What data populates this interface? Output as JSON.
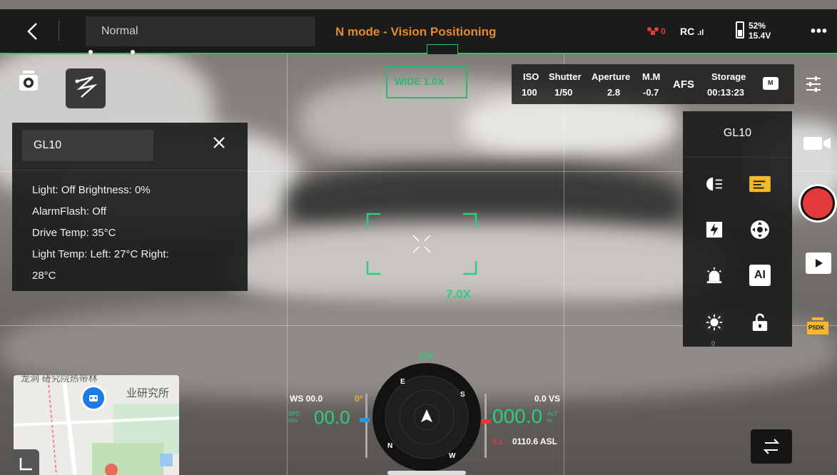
{
  "topbar": {
    "mode": "Normal",
    "status": "N mode - Vision Positioning",
    "drone_count": "0",
    "rc_label": "RC",
    "battery_percent": "52%",
    "battery_voltage": "15.4V",
    "more": "•••"
  },
  "lens": {
    "wide": "WIDE 1.0X",
    "zoom": "7.0X"
  },
  "gl10_panel": {
    "title": "GL10",
    "lines": [
      "Light: Off   Brightness: 0%",
      "AlarmFlash: Off",
      "Drive Temp: 35°C",
      "Light Temp: Left: 27°C  Right:",
      "28°C"
    ]
  },
  "exposure": {
    "iso_label": "ISO",
    "iso_value": "100",
    "shutter_label": "Shutter",
    "shutter_value": "1/50",
    "aperture_label": "Aperture",
    "aperture_value": "2.8",
    "mm_label": "M.M",
    "mm_value": "-0.7",
    "focus_mode": "AFS",
    "storage_label": "Storage",
    "storage_value": "00:13:23",
    "storage_badge": "M"
  },
  "tool_panel": {
    "title": "GL10",
    "ai_label": "AI",
    "brightness_value": "0",
    "active_color": "#f5b82e"
  },
  "psdk_label": "PSDK",
  "map": {
    "label_main": "业研究所",
    "label_top": "龙洞      研究院热带林"
  },
  "flight": {
    "ws": "WS 00.0",
    "ws_deg": "0°",
    "spd_label_1": "SPD",
    "spd_label_2": "m/s",
    "speed": "00.0",
    "vs": "0.0 VS",
    "alt": "000.0",
    "alt_label_1": "ALT",
    "alt_label_2": "m",
    "asl_red": "0.1",
    "asl": "0110.6 ASL",
    "heading": "124",
    "compass_n": "N",
    "compass_e": "E",
    "compass_s": "S",
    "compass_w": "W"
  },
  "colors": {
    "accent_green": "#2bc46b",
    "accent_orange": "#e6892b",
    "record_red": "#e23a3a"
  }
}
